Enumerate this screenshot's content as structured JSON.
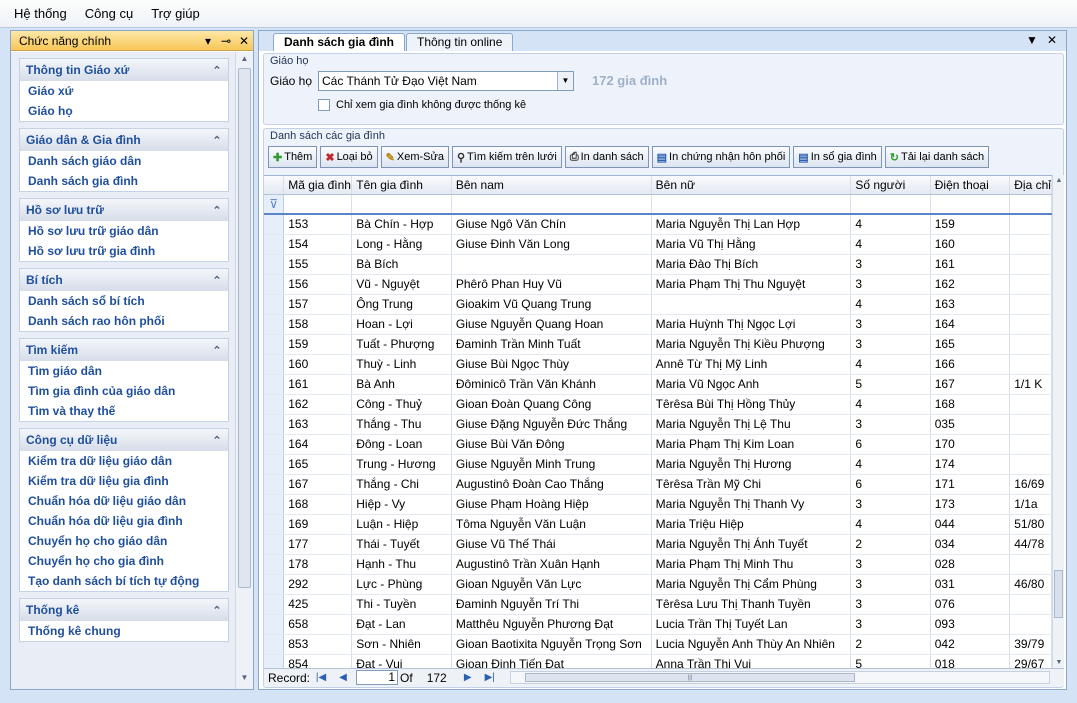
{
  "menu": [
    "Hệ thống",
    "Công cụ",
    "Trợ giúp"
  ],
  "left_panel": {
    "title": "Chức năng chính",
    "groups": [
      {
        "title": "Thông tin Giáo xứ",
        "items": [
          "Giáo xứ",
          "Giáo họ"
        ]
      },
      {
        "title": "Giáo dân & Gia đình",
        "items": [
          "Danh sách giáo dân",
          "Danh sách gia đình"
        ]
      },
      {
        "title": "Hồ sơ lưu trữ",
        "items": [
          "Hồ sơ lưu trữ giáo dân",
          "Hồ sơ lưu trữ gia đình"
        ]
      },
      {
        "title": "Bí tích",
        "items": [
          "Danh sách sổ bí tích",
          "Danh sách rao hôn phối"
        ]
      },
      {
        "title": "Tìm kiếm",
        "items": [
          "Tìm giáo dân",
          "Tìm gia đình của giáo dân",
          "Tìm và thay thế"
        ]
      },
      {
        "title": "Công cụ dữ liệu",
        "items": [
          "Kiểm tra dữ liệu giáo dân",
          "Kiểm tra dữ liệu gia đình",
          "Chuẩn hóa dữ liệu giáo dân",
          "Chuẩn hóa dữ liệu gia đình",
          "Chuyển họ cho giáo dân",
          "Chuyển họ cho gia đình",
          "Tạo danh sách bí tích tự động"
        ]
      },
      {
        "title": "Thống kê",
        "items": [
          "Thống kê chung"
        ]
      }
    ]
  },
  "tabs": {
    "active": "Danh sách gia đình",
    "inactive": "Thông tin online"
  },
  "filter": {
    "legend": "Giáo họ",
    "label": "Giáo họ",
    "selected": "Các Thánh Tử Đạo Việt Nam",
    "count": "172 gia đình",
    "checkbox_label": "Chỉ xem gia đình không được thống kê"
  },
  "list": {
    "legend": "Danh sách các gia đình",
    "buttons": [
      {
        "label": "Thêm",
        "icon": "plus-icon",
        "glyph": "✚",
        "color": "#2e9b2e"
      },
      {
        "label": "Loại bỏ",
        "icon": "delete-icon",
        "glyph": "✖",
        "color": "#c0262b"
      },
      {
        "label": "Xem-Sửa",
        "icon": "edit-icon",
        "glyph": "✎",
        "color": "#b8860b"
      },
      {
        "label": "Tìm kiếm trên lưới",
        "icon": "binoculars-icon",
        "glyph": "⚲",
        "color": "#333333"
      },
      {
        "label": "In danh sách",
        "icon": "printer-icon",
        "glyph": "⎙",
        "color": "#333333"
      },
      {
        "label": "In chứng nhận hôn phối",
        "icon": "certificate-icon",
        "glyph": "▤",
        "color": "#2b5fb3"
      },
      {
        "label": "In sổ gia đình",
        "icon": "book-icon",
        "glyph": "▤",
        "color": "#2b5fb3"
      },
      {
        "label": "Tải lại danh sách",
        "icon": "refresh-icon",
        "glyph": "↻",
        "color": "#2e9b2e"
      }
    ],
    "columns": [
      "Mã gia đình",
      "Tên gia đình",
      "Bên nam",
      "Bên nữ",
      "Số người",
      "Điện thoại",
      "Địa chỉ"
    ],
    "rows": [
      [
        "153",
        "Bà Chín - Hợp",
        "Giuse Ngô Văn Chín",
        "Maria Nguyễn Thị Lan Hợp",
        "4",
        "159",
        ""
      ],
      [
        "154",
        "Long - Hằng",
        "Giuse Đinh Văn Long",
        "Maria Vũ Thị Hằng",
        "4",
        "160",
        ""
      ],
      [
        "155",
        "Bà Bích",
        "",
        "Maria Đào Thị Bích",
        "3",
        "161",
        ""
      ],
      [
        "156",
        "Vũ - Nguyệt",
        "Phêrô Phan Huy Vũ",
        "Maria Phạm Thị Thu Nguyệt",
        "3",
        "162",
        ""
      ],
      [
        "157",
        "Ông Trung",
        "Gioakim Vũ Quang Trung",
        "",
        "4",
        "163",
        ""
      ],
      [
        "158",
        "Hoan - Lợi",
        "Giuse Nguyễn Quang Hoan",
        "Maria Huỳnh Thị Ngọc Lợi",
        "3",
        "164",
        ""
      ],
      [
        "159",
        "Tuất - Phượng",
        "Đaminh Trần Minh Tuất",
        "Maria Nguyễn Thị Kiều Phượng",
        "3",
        "165",
        ""
      ],
      [
        "160",
        "Thuỳ - Linh",
        "Giuse Bùi Ngọc Thùy",
        "Annê Từ Thị Mỹ Linh",
        "4",
        "166",
        ""
      ],
      [
        "161",
        "Bà Anh",
        "Đôminicô Trần Văn Khánh",
        "Maria Vũ Ngọc Anh",
        "5",
        "167",
        "1/1 K"
      ],
      [
        "162",
        "Công - Thuỷ",
        "Gioan Đoàn Quang Công",
        "Têrêsa Bùi Thị Hồng Thủy",
        "4",
        "168",
        ""
      ],
      [
        "163",
        "Thắng - Thu",
        "Giuse Đặng Nguyễn Đức Thắng",
        "Maria Nguyễn Thị Lệ Thu",
        "3",
        "035",
        ""
      ],
      [
        "164",
        "Đông - Loan",
        "Giuse Bùi Văn Đông",
        "Maria Phạm Thị Kim Loan",
        "6",
        "170",
        ""
      ],
      [
        "165",
        "Trung - Hương",
        "Giuse Nguyễn Minh Trung",
        "Maria Nguyễn Thị Hương",
        "4",
        "174",
        ""
      ],
      [
        "167",
        "Thắng - Chi",
        "Augustinô Đoàn Cao Thắng",
        "Têrêsa Trần Mỹ Chi",
        "6",
        "171",
        "16/69"
      ],
      [
        "168",
        "Hiệp - Vy",
        "Giuse Phạm Hoàng Hiệp",
        "Maria Nguyễn Thị Thanh Vy",
        "3",
        "173",
        "1/1a"
      ],
      [
        "169",
        "Luận - Hiệp",
        "Tôma Nguyễn Văn Luận",
        "Maria Triệu Hiệp",
        "4",
        "044",
        "51/80"
      ],
      [
        "177",
        "Thái - Tuyết",
        "Giuse Vũ Thế Thái",
        "Maria Nguyễn Thị Ánh Tuyết",
        "2",
        "034",
        "44/78"
      ],
      [
        "178",
        "Hạnh - Thu",
        "Augustinô Trần Xuân Hạnh",
        "Maria Phạm Thị Minh Thu",
        "3",
        "028",
        ""
      ],
      [
        "292",
        "Lực - Phùng",
        "Gioan Nguyễn Văn Lực",
        "Maria Nguyễn Thị Cẩm Phùng",
        "3",
        "031",
        "46/80"
      ],
      [
        "425",
        "Thi - Tuyền",
        "Đaminh Nguyễn Trí Thi",
        "Têrêsa Lưu Thị Thanh Tuyền",
        "3",
        "076",
        ""
      ],
      [
        "658",
        "Đạt - Lan",
        "Matthêu Nguyễn Phương Đạt",
        "Lucia Trần Thị Tuyết Lan",
        "3",
        "093",
        ""
      ],
      [
        "853",
        "Sơn - Nhiên",
        "Gioan Baotixita Nguyễn Trọng Sơn",
        "Lucia Nguyễn Anh Thùy An Nhiên",
        "2",
        "042",
        "39/79"
      ],
      [
        "854",
        "Đạt - Vui",
        "Gioan Đinh Tiến Đạt",
        "Anna Trần Thị Vui",
        "5",
        "018",
        "29/67"
      ]
    ]
  },
  "navigator": {
    "label": "Record:",
    "current": "1",
    "of_label": "Of",
    "total": "172"
  }
}
